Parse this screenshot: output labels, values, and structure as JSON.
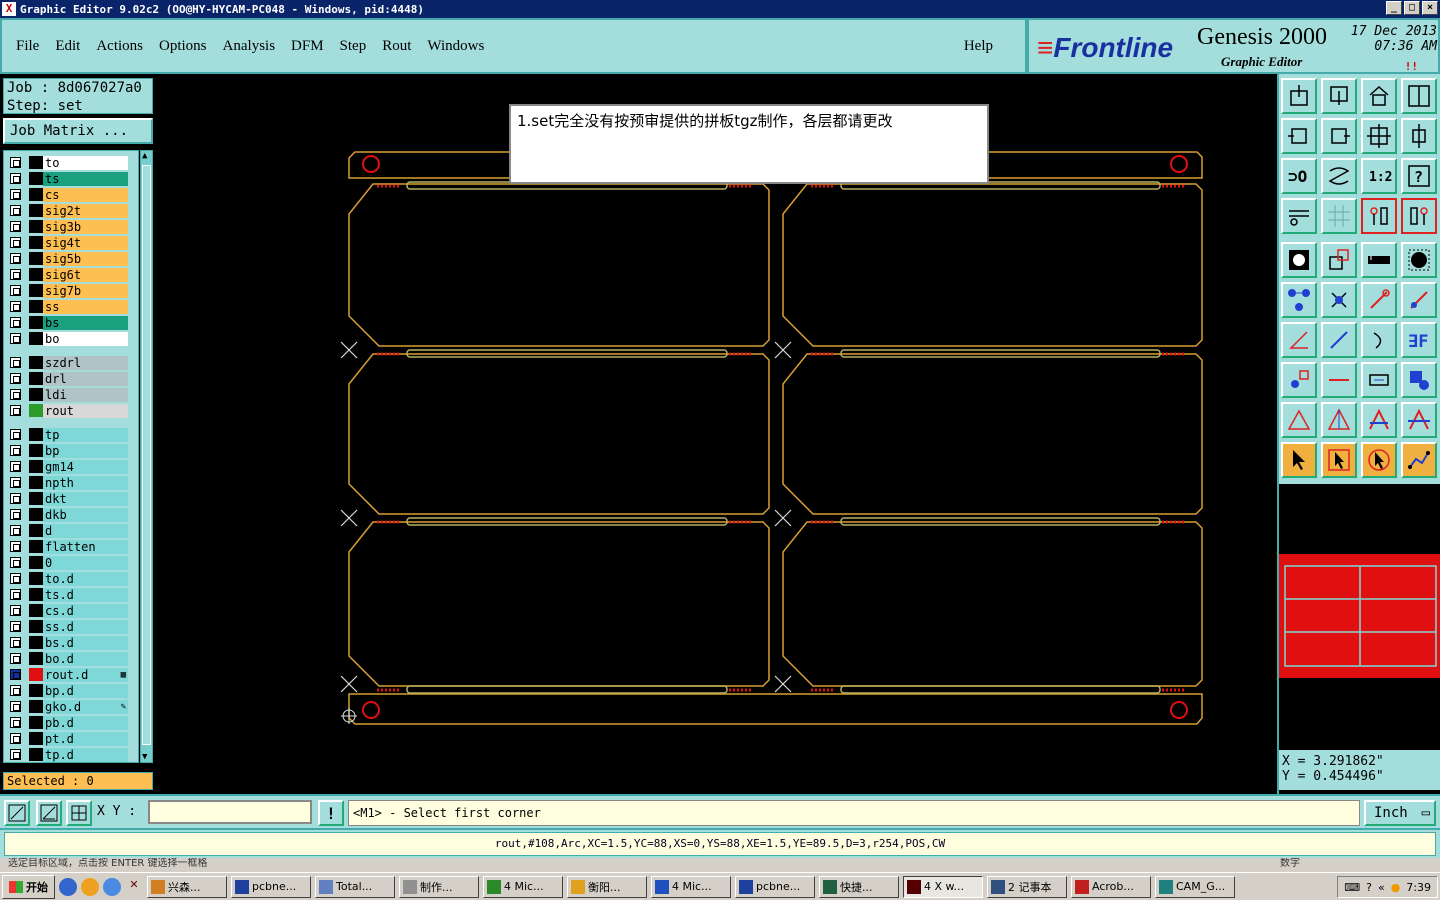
{
  "window": {
    "title": "Graphic Editor 9.02c2  (OO@HY-HYCAM-PC048 - Windows, pid:4448)",
    "min": "_",
    "max": "□",
    "close": "×"
  },
  "menu": {
    "items": [
      "File",
      "Edit",
      "Actions",
      "Options",
      "Analysis",
      "DFM",
      "Step",
      "Rout",
      "Windows"
    ],
    "help": "Help"
  },
  "brand": {
    "logo": "Frontline",
    "product": "Genesis 2000",
    "subtitle": "Graphic Editor",
    "date": "17  Dec  2013",
    "time": "07:36  AM",
    "alert": "!!"
  },
  "job": {
    "job_line": "Job  :  8d067027a0",
    "step_line": "Step:  set",
    "matrix_button": "Job Matrix ..."
  },
  "layers": [
    {
      "name": "to",
      "color": "#ffffff",
      "group": 0
    },
    {
      "name": "ts",
      "color": "#1aa07e",
      "group": 0
    },
    {
      "name": "cs",
      "color": "#ffbe52",
      "group": 0
    },
    {
      "name": "sig2t",
      "color": "#ffbe52",
      "group": 0
    },
    {
      "name": "sig3b",
      "color": "#ffbe52",
      "group": 0
    },
    {
      "name": "sig4t",
      "color": "#ffbe52",
      "group": 0
    },
    {
      "name": "sig5b",
      "color": "#ffbe52",
      "group": 0
    },
    {
      "name": "sig6t",
      "color": "#ffbe52",
      "group": 0
    },
    {
      "name": "sig7b",
      "color": "#ffbe52",
      "group": 0
    },
    {
      "name": "ss",
      "color": "#ffbe52",
      "group": 0
    },
    {
      "name": "bs",
      "color": "#1aa07e",
      "group": 0
    },
    {
      "name": "bo",
      "color": "#ffffff",
      "group": 0
    },
    {
      "name": "szdrl",
      "color": "#b0c4c8",
      "group": 1
    },
    {
      "name": "drl",
      "color": "#b0c4c8",
      "group": 1
    },
    {
      "name": "ldi",
      "color": "#b0c4c8",
      "group": 1
    },
    {
      "name": "rout",
      "color": "#d8d8d8",
      "group": 1,
      "swatch": "#2a9a2a"
    },
    {
      "name": "tp",
      "color": "#7fd8d8",
      "group": 2
    },
    {
      "name": "bp",
      "color": "#7fd8d8",
      "group": 2
    },
    {
      "name": "gm14",
      "color": "#7fd8d8",
      "group": 2
    },
    {
      "name": "npth",
      "color": "#7fd8d8",
      "group": 2
    },
    {
      "name": "dkt",
      "color": "#7fd8d8",
      "group": 2
    },
    {
      "name": "dkb",
      "color": "#7fd8d8",
      "group": 2
    },
    {
      "name": "d",
      "color": "#7fd8d8",
      "group": 2
    },
    {
      "name": "flatten",
      "color": "#7fd8d8",
      "group": 2
    },
    {
      "name": "0",
      "color": "#7fd8d8",
      "group": 2
    },
    {
      "name": "to.d",
      "color": "#7fd8d8",
      "group": 2
    },
    {
      "name": "ts.d",
      "color": "#7fd8d8",
      "group": 2
    },
    {
      "name": "cs.d",
      "color": "#7fd8d8",
      "group": 2
    },
    {
      "name": "ss.d",
      "color": "#7fd8d8",
      "group": 2
    },
    {
      "name": "bs.d",
      "color": "#7fd8d8",
      "group": 2
    },
    {
      "name": "bo.d",
      "color": "#7fd8d8",
      "group": 2
    },
    {
      "name": "rout.d",
      "color": "#7fd8d8",
      "group": 2,
      "swatch": "#e01010",
      "active": true,
      "mark": "▦"
    },
    {
      "name": "bp.d",
      "color": "#7fd8d8",
      "group": 2
    },
    {
      "name": "gko.d",
      "color": "#7fd8d8",
      "group": 2,
      "mark": "✎"
    },
    {
      "name": "pb.d",
      "color": "#7fd8d8",
      "group": 2
    },
    {
      "name": "pt.d",
      "color": "#7fd8d8",
      "group": 2
    },
    {
      "name": "tp.d",
      "color": "#7fd8d8",
      "group": 2
    }
  ],
  "selected_text": "Selected : 0",
  "note": "1.set完全没有按预审提供的拼板tgz制作，各层都请更改",
  "toolbox": {
    "row_a": [
      "open-step-icon",
      "save-icon",
      "home-icon",
      "window-split-icon",
      "zoom-home-icon",
      "zoom-in-icon",
      "zoom-fit-icon",
      "snap-icon",
      "pan-icon",
      "pan-center-icon",
      "scale-1-2-icon",
      "query-icon",
      "measure-icon",
      "grid-icon",
      "layer-compare-icon",
      "layer-compare-alt-icon"
    ],
    "row_b": [
      "film-icon",
      "transform-icon",
      "ruler-icon",
      "pad-icon",
      "connect-icon",
      "delete-icon",
      "move-icon",
      "move-copy-icon",
      "angle-icon",
      "line-icon",
      "arc-icon",
      "flip-icon",
      "add-pad-icon",
      "minus-icon",
      "resize-icon",
      "contour-icon",
      "rotate-icon",
      "rout-a-icon",
      "rout-b-icon",
      "rout-c-icon",
      "select-icon",
      "select-box-icon",
      "select-net-icon",
      "path-icon"
    ],
    "label_1_2": "1:2",
    "label_q": "?"
  },
  "coords": {
    "x": "X  =  3.291862\"",
    "y": "Y  =  0.454496\""
  },
  "cmd": {
    "xy_label": "X Y :",
    "xy_value": "",
    "message": "<M1> - Select first corner",
    "unit": "Inch",
    "excl": "!"
  },
  "status": "rout,#108,Arc,XC=1.5,YC=88,XS=0,YS=88,XE=1.5,YE=89.5,D=3,r254,POS,CW",
  "behind_text": "选定目标区域，点击按 ENTER 键选择一框格",
  "behind_right": "数字",
  "taskbar": {
    "start": "开始",
    "tasks": [
      "兴森...",
      "pcbne...",
      "Total...",
      "制作...",
      "4 Mic...",
      "衡阳...",
      "4 Mic...",
      "pcbne...",
      "快捷...",
      "4 X w...",
      "2 记事本",
      "Acrob...",
      "CAM_G..."
    ],
    "clock": "7:39"
  }
}
